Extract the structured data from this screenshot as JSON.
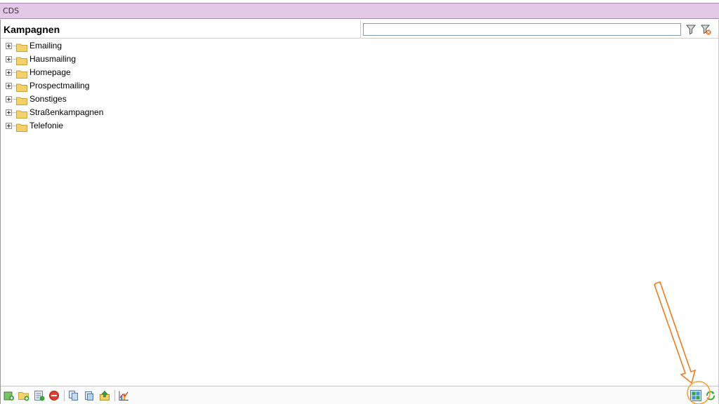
{
  "window": {
    "title": "CDS"
  },
  "header": {
    "title": "Kampagnen",
    "search": {
      "value": "",
      "placeholder": ""
    }
  },
  "tree": {
    "items": [
      {
        "label": "Emailing"
      },
      {
        "label": "Hausmailing"
      },
      {
        "label": "Homepage"
      },
      {
        "label": "Prospectmailing"
      },
      {
        "label": "Sonstiges"
      },
      {
        "label": "Straßenkampagnen"
      },
      {
        "label": "Telefonie"
      }
    ]
  },
  "icons": {
    "header": [
      "filter-icon",
      "clear-filter-icon"
    ],
    "toolbar": [
      "add-campaign-icon",
      "add-folder-icon",
      "edit-icon",
      "delete-icon",
      "copy-icon",
      "duplicate-icon",
      "export-icon",
      "chart-icon"
    ],
    "toolbar_right": [
      "view-layout-icon",
      "refresh-icon"
    ]
  },
  "colors": {
    "titlebar": "#e3c8e7",
    "folder": "#f3d26e",
    "annotation_arrow": "#f07a1e"
  }
}
